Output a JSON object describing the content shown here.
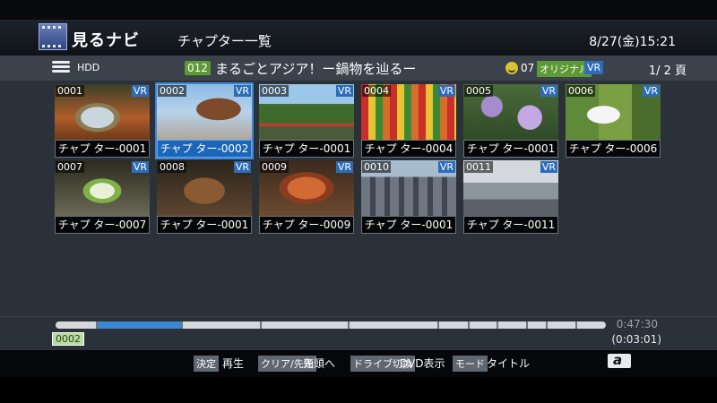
{
  "header": {
    "app_title": "見るナビ",
    "screen_title": "チャプター一覧",
    "datetime": "8/27(金)15:21"
  },
  "infobar": {
    "source": "HDD",
    "title_number": "012",
    "title": "まるごとアジア！ー鍋物を辿るー",
    "chapter_count": "07",
    "original_badge": "オリジナル",
    "vr_badge": "VR",
    "page": "1/ 2 頁"
  },
  "chapters": [
    {
      "num": "0001",
      "label": "チャプ ター-0001",
      "vr": "VR",
      "scene": "s1"
    },
    {
      "num": "0002",
      "label": "チャプ ター-0002",
      "vr": "VR",
      "scene": "s2",
      "selected": true
    },
    {
      "num": "0003",
      "label": "チャプ ター-0001",
      "vr": "VR",
      "scene": "s3"
    },
    {
      "num": "0004",
      "label": "チャプ ター-0004",
      "vr": "VR",
      "scene": "s4"
    },
    {
      "num": "0005",
      "label": "チャプ ター-0001",
      "vr": "VR",
      "scene": "s5"
    },
    {
      "num": "0006",
      "label": "チャプ ター-0006",
      "vr": "VR",
      "scene": "s6"
    },
    {
      "num": "0007",
      "label": "チャプ ター-0007",
      "vr": "VR",
      "scene": "s7"
    },
    {
      "num": "0008",
      "label": "チャプ ター-0001",
      "vr": "VR",
      "scene": "s8"
    },
    {
      "num": "0009",
      "label": "チャプ ター-0009",
      "vr": "VR",
      "scene": "s9"
    },
    {
      "num": "0010",
      "label": "チャプ ター-0001",
      "vr": "VR",
      "scene": "s10"
    },
    {
      "num": "0011",
      "label": "チャプ ター-0011",
      "vr": "VR",
      "scene": "s11"
    }
  ],
  "timeline": {
    "total_time": "0:47:30",
    "selected_chapter": "0002",
    "selected_duration": "(0:03:01)"
  },
  "footer": {
    "keys": [
      {
        "key": "決定",
        "label": "再生"
      },
      {
        "key": "クリア/先頭",
        "label": "先頭へ"
      },
      {
        "key": "ドライブ切換",
        "label": "DVD表示"
      },
      {
        "key": "モード",
        "label": "タイトル"
      }
    ],
    "logo_glyph": "a"
  },
  "colors": {
    "accent": "#3c86d6",
    "green_badge": "#5d9a35",
    "vr_badge": "#2d6cb8"
  }
}
